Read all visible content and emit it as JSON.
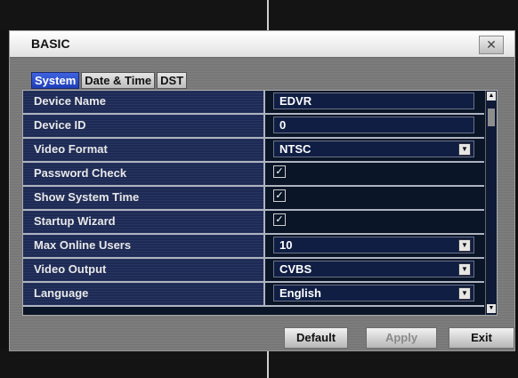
{
  "dialog": {
    "title": "BASIC",
    "close_icon": "close-icon"
  },
  "tabs": [
    {
      "label": "System",
      "active": true
    },
    {
      "label": "Date & Time",
      "active": false
    },
    {
      "label": "DST",
      "active": false
    }
  ],
  "settings": [
    {
      "label": "Device Name",
      "type": "text",
      "value": "EDVR"
    },
    {
      "label": "Device ID",
      "type": "text",
      "value": "0"
    },
    {
      "label": "Video Format",
      "type": "select",
      "value": "NTSC"
    },
    {
      "label": "Password Check",
      "type": "checkbox",
      "checked": true
    },
    {
      "label": "Show System Time",
      "type": "checkbox",
      "checked": true
    },
    {
      "label": "Startup Wizard",
      "type": "checkbox",
      "checked": true
    },
    {
      "label": "Max Online Users",
      "type": "select",
      "value": "10"
    },
    {
      "label": "Video Output",
      "type": "select",
      "value": "CVBS"
    },
    {
      "label": "Language",
      "type": "select",
      "value": "English"
    }
  ],
  "footer": {
    "default_label": "Default",
    "apply_label": "Apply",
    "exit_label": "Exit"
  },
  "colors": {
    "active_tab": "#2f52d0",
    "label_bg": "#1d2a55",
    "value_bg": "#101e44"
  }
}
